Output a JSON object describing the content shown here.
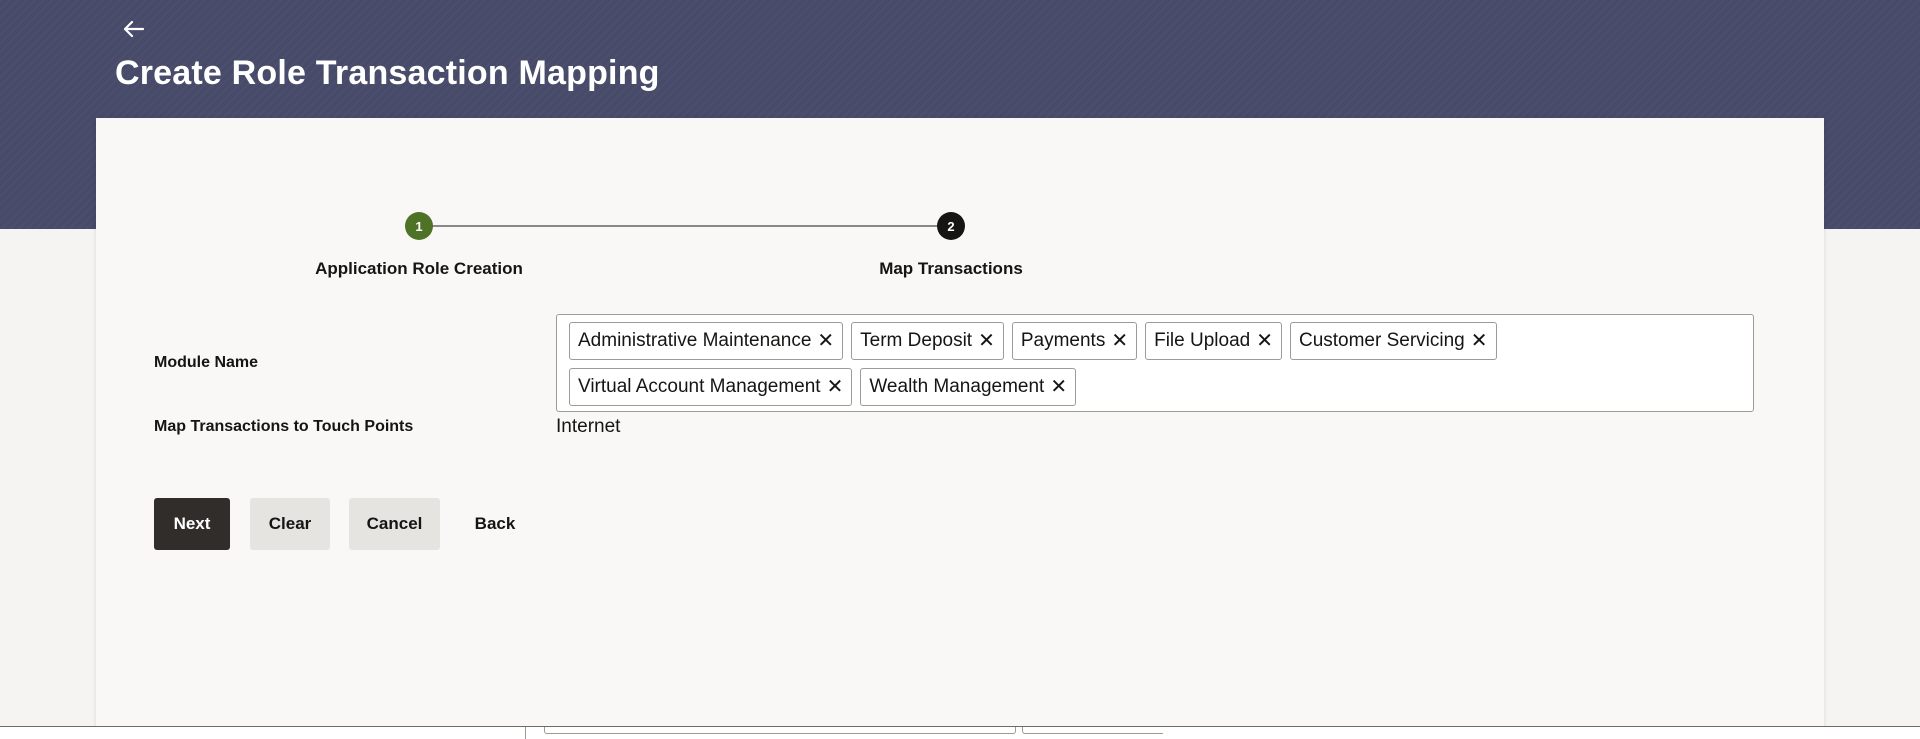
{
  "header": {
    "back_icon": "arrow-left-icon",
    "title": "Create Role Transaction Mapping"
  },
  "stepper": {
    "steps": [
      {
        "number": "1",
        "label": "Application Role Creation",
        "state": "completed",
        "color": "#4f7326"
      },
      {
        "number": "2",
        "label": "Map Transactions",
        "state": "current",
        "color": "#161513"
      }
    ]
  },
  "form": {
    "module_name": {
      "label": "Module Name",
      "selected": [
        "Administrative Maintenance",
        "Term Deposit",
        "Payments",
        "File Upload",
        "Customer Servicing",
        "Virtual Account Management",
        "Wealth Management"
      ],
      "remove_glyph": "✕"
    },
    "touch_points": {
      "label": "Map Transactions to Touch Points",
      "value": "Internet"
    }
  },
  "actions": {
    "next": "Next",
    "clear": "Clear",
    "cancel": "Cancel",
    "back": "Back"
  },
  "colors": {
    "banner": "#474b69",
    "primary_button": "#312d2a",
    "secondary_button": "#e5e4e1"
  }
}
